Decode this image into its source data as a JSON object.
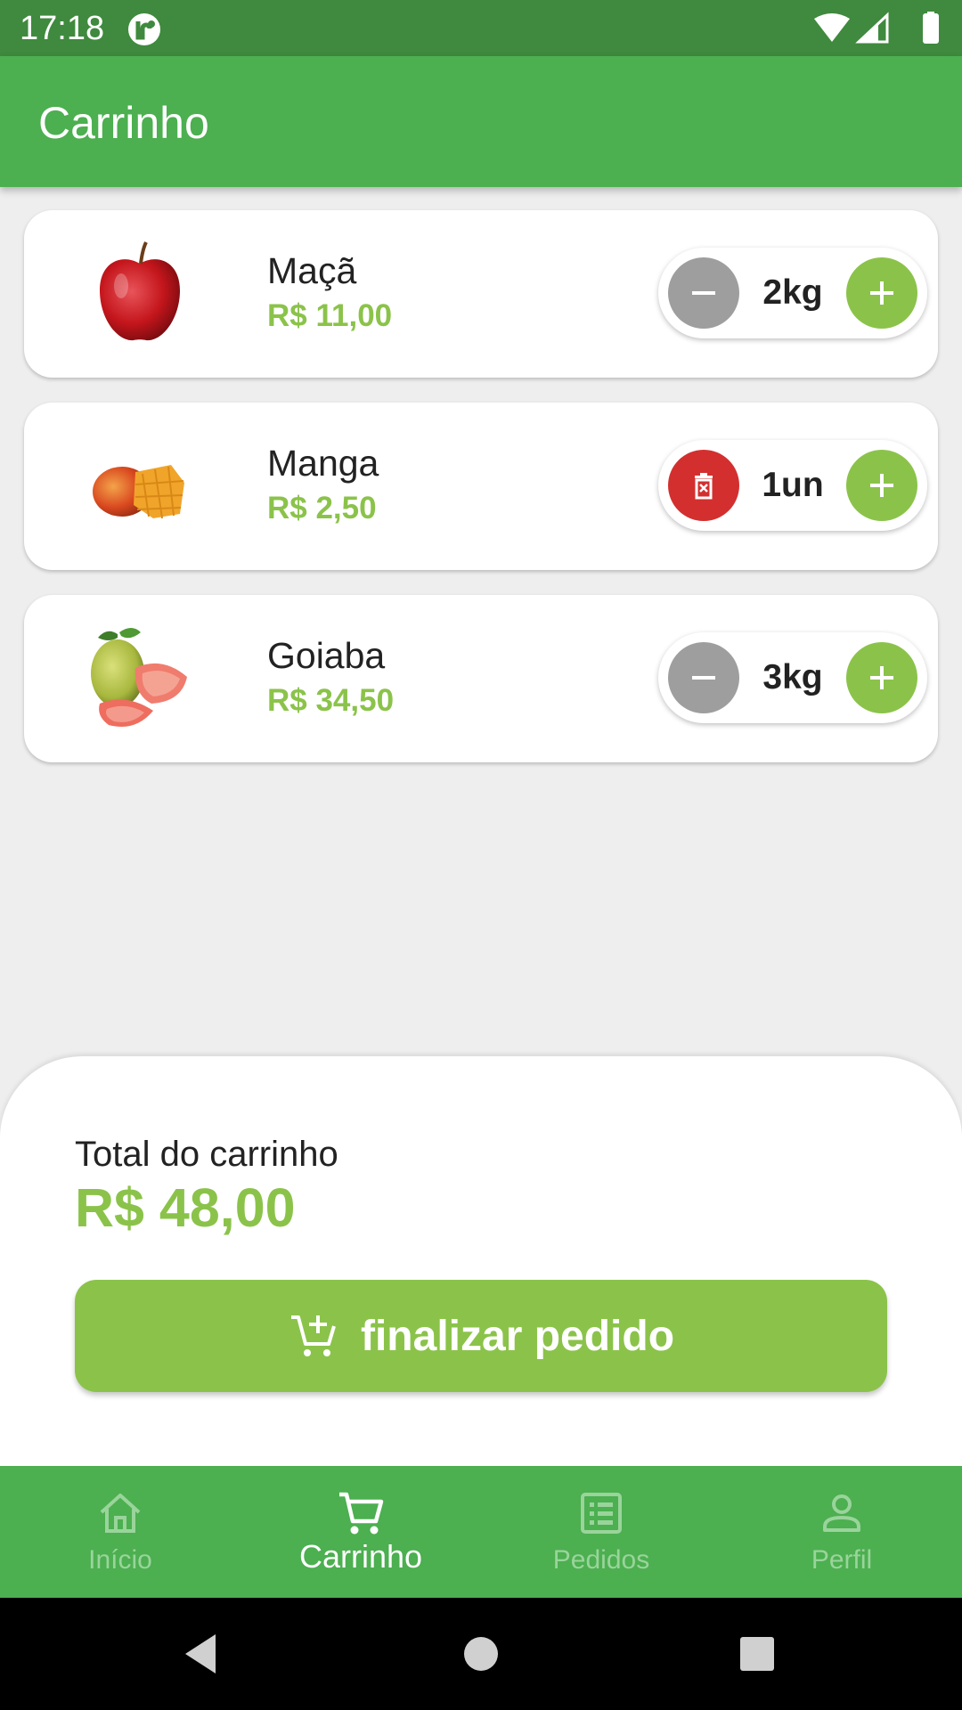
{
  "status_bar": {
    "time": "17:18"
  },
  "app_bar": {
    "title": "Carrinho"
  },
  "cart_items": [
    {
      "name": "Maçã",
      "price": "R$ 11,00",
      "quantity": "2kg",
      "left_action": "decrement",
      "image": "apple"
    },
    {
      "name": "Manga",
      "price": "R$ 2,50",
      "quantity": "1un",
      "left_action": "delete",
      "image": "mango"
    },
    {
      "name": "Goiaba",
      "price": "R$ 34,50",
      "quantity": "3kg",
      "left_action": "decrement",
      "image": "guava"
    }
  ],
  "summary": {
    "total_label": "Total do carrinho",
    "total_value": "R$ 48,00",
    "checkout_label": "finalizar pedido",
    "checkout_icon": "add-cart-icon"
  },
  "bottom_nav": {
    "items": [
      {
        "label": "Início",
        "icon": "home-icon",
        "active": false
      },
      {
        "label": "Carrinho",
        "icon": "cart-icon",
        "active": true
      },
      {
        "label": "Pedidos",
        "icon": "list-icon",
        "active": false
      },
      {
        "label": "Perfil",
        "icon": "person-icon",
        "active": false
      }
    ]
  },
  "colors": {
    "primary": "#4caf50",
    "status_bar": "#3f8a3e",
    "accent": "#8bc34a",
    "delete": "#d32f2f",
    "decrement": "#9e9e9e"
  }
}
